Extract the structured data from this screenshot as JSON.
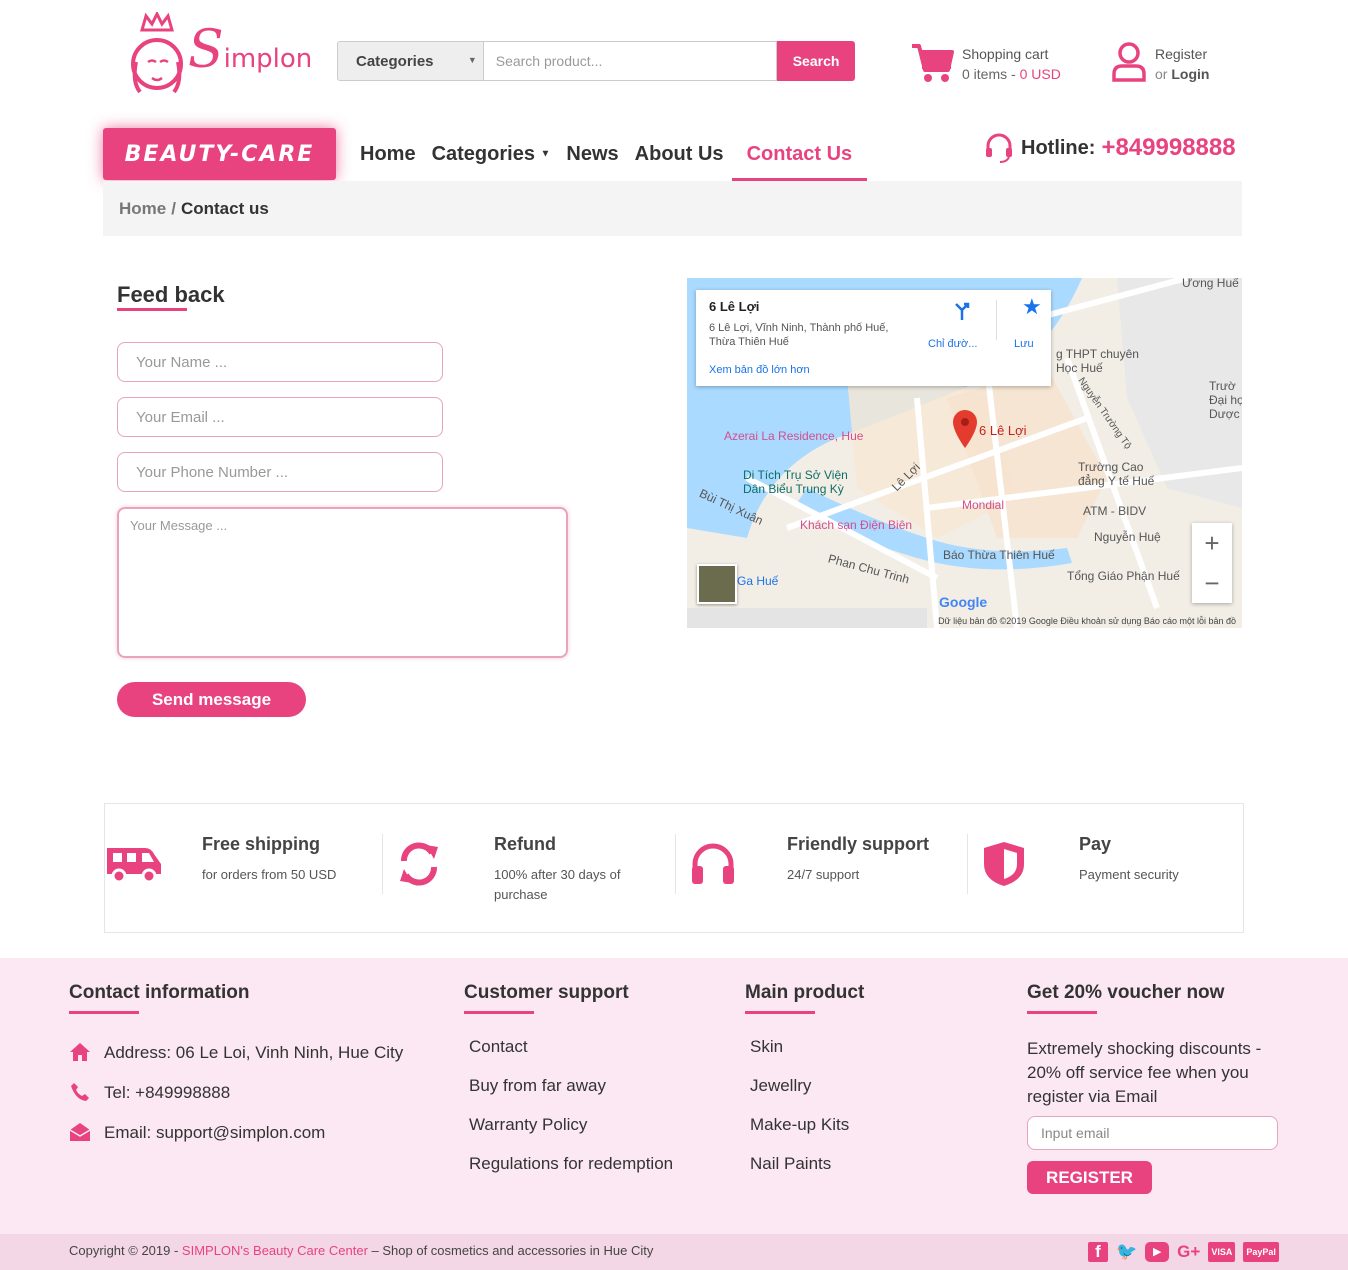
{
  "brand": {
    "name": "implon",
    "initial": "S",
    "badge": "BEAUTY-CARE",
    "accent": "#e8437e"
  },
  "search": {
    "category_label": "Categories",
    "placeholder": "Search product...",
    "button": "Search"
  },
  "cart": {
    "title": "Shopping cart",
    "items": "0 items - ",
    "total": "0 USD"
  },
  "account": {
    "register": "Register",
    "or": "or ",
    "login": "Login"
  },
  "nav": {
    "home": "Home",
    "categories": "Categories",
    "news": "News",
    "about": "About Us",
    "contact": "Contact Us"
  },
  "hotline": {
    "label": "Hotline:",
    "number": "+849998888"
  },
  "breadcrumb": {
    "home": "Home",
    "sep": "/",
    "current": "Contact us"
  },
  "feedback": {
    "title": "Feed back",
    "name_placeholder": "Your Name ...",
    "email_placeholder": "Your Email ...",
    "phone_placeholder": "Your Phone Number ...",
    "message_placeholder": "Your Message ...",
    "send": "Send message"
  },
  "map": {
    "place_title": "6 Lê Lợi",
    "place_address": "6 Lê Lợi, Vĩnh Ninh, Thành phố Huế, Thừa Thiên Huế",
    "larger_map": "Xem bản đồ lớn hơn",
    "directions": "Chỉ đườ...",
    "save": "Lưu",
    "pin_label": "6 Lê Lợi",
    "labels": {
      "azerai": "Azerai La Residence, Hue",
      "ditich": "Di Tích Trụ Sở Viện\nDân Biểu Trung Kỳ",
      "khachsan": "Khách sạn Điện Biên",
      "mondial": "Mondial",
      "atm": "ATM - BIDV",
      "nguyenhue": "Nguyễn Huệ",
      "baott": "Báo Thừa Thiên Huế",
      "tonggiao": "Tổng Giáo Phận Huế",
      "gahue": "Ga Huế",
      "phanchutrinh": "Phan Chu Trinh",
      "buithixuan": "Bùi Thị Xuân",
      "leloi": "Lê Lợi",
      "thpt": "g THPT chuyên\nHọc Huế",
      "truongcao": "Trường Cao\nđẳng Y tế Huế",
      "nguyentruongto": "Nguyễn Trường Tộ",
      "truongdh": "Trườ\nĐại họ\nDược H",
      "uonghue": "Ương Huế",
      "google": "Google"
    },
    "footer": "Dữ liệu bản đồ ©2019 Google   Điều khoản sử dụng   Báo cáo một lỗi bản đồ"
  },
  "features": [
    {
      "icon": "truck-icon",
      "title": "Free shipping",
      "sub": "for orders from 50 USD"
    },
    {
      "icon": "refresh-icon",
      "title": "Refund",
      "sub": "100% after 30 days of purchase"
    },
    {
      "icon": "headphones-icon",
      "title": "Friendly support",
      "sub": "24/7 support"
    },
    {
      "icon": "shield-icon",
      "title": "Pay",
      "sub": "Payment security"
    }
  ],
  "footer": {
    "contact": {
      "title": "Contact information",
      "address": "Address: 06 Le Loi, Vinh Ninh, Hue City",
      "tel": "Tel: +849998888",
      "email": "Email: support@simplon.com"
    },
    "support": {
      "title": "Customer support",
      "links": [
        "Contact",
        "Buy from far away",
        "Warranty Policy",
        "Regulations for redemption"
      ]
    },
    "products": {
      "title": "Main product",
      "links": [
        "Skin",
        "Jewellry",
        "Make-up Kits",
        "Nail Paints"
      ]
    },
    "voucher": {
      "title": "Get 20% voucher now",
      "text": "Extremely shocking discounts - 20% off service fee when you register via Email",
      "placeholder": "Input email",
      "button": "REGISTER"
    }
  },
  "copyright": {
    "prefix": "Copyright © 2019 - ",
    "brand": "SIMPLON's Beauty Care Center",
    "suffix": " – Shop of cosmetics and accessories in Hue City"
  },
  "social": {
    "visa": "VISA",
    "paypal": "PayPal"
  }
}
